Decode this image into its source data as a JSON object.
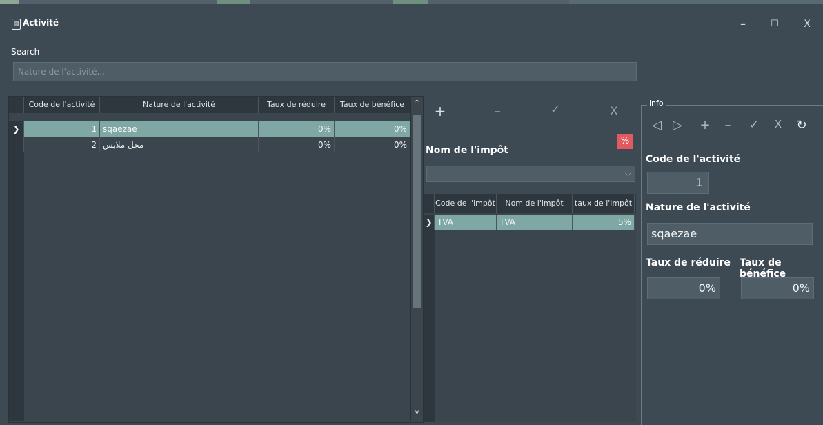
{
  "window": {
    "title": "Activité",
    "app_icon": "app-document-icon",
    "controls": {
      "minimize": "–",
      "maximize": "☐",
      "close": "X"
    }
  },
  "search": {
    "label": "Search",
    "placeholder": "Nature de l'activité..."
  },
  "activities_table": {
    "columns": [
      "Code de l'activité",
      "Nature de l'activité",
      "Taux de réduire",
      "Taux de bénéfice"
    ],
    "rows": [
      {
        "indicator": "❯",
        "code": "1",
        "nature": "sqaezae",
        "reduire": "0%",
        "benefice": "0%"
      },
      {
        "indicator": "",
        "code": "2",
        "nature": "محل ملابس",
        "reduire": "0%",
        "benefice": "0%"
      }
    ],
    "scroll_up": "^",
    "scroll_down": "v"
  },
  "tax_panel": {
    "toolbar": {
      "add": "+",
      "remove": "–",
      "confirm": "✓",
      "cancel": "X"
    },
    "percent_button": "%",
    "nom_label": "Nom de l'impôt",
    "combo_value": "",
    "columns": [
      "Code de l'impôt",
      "Nom de l'impôt",
      "taux de l'impôt"
    ],
    "rows": [
      {
        "indicator": "❯",
        "code": "TVA",
        "nom": "TVA",
        "taux": "5%"
      }
    ]
  },
  "info": {
    "title": "info",
    "toolbar": {
      "prev": "◁",
      "next": "▷",
      "add": "+",
      "remove": "–",
      "confirm": "✓",
      "cancel": "X",
      "refresh": "↻"
    },
    "code_label": "Code de l'activité",
    "code_value": "1",
    "nature_label": "Nature de l'activité",
    "nature_value": "sqaezae",
    "reduire_label": "Taux de réduire",
    "reduire_value": "0%",
    "benefice_label": "Taux de bénéfice",
    "benefice_value": "0%"
  },
  "colors": {
    "background": "#3e4a53",
    "selection": "#7fa7a3",
    "header": "#2e373d",
    "percent_button": "#e15a5f"
  }
}
